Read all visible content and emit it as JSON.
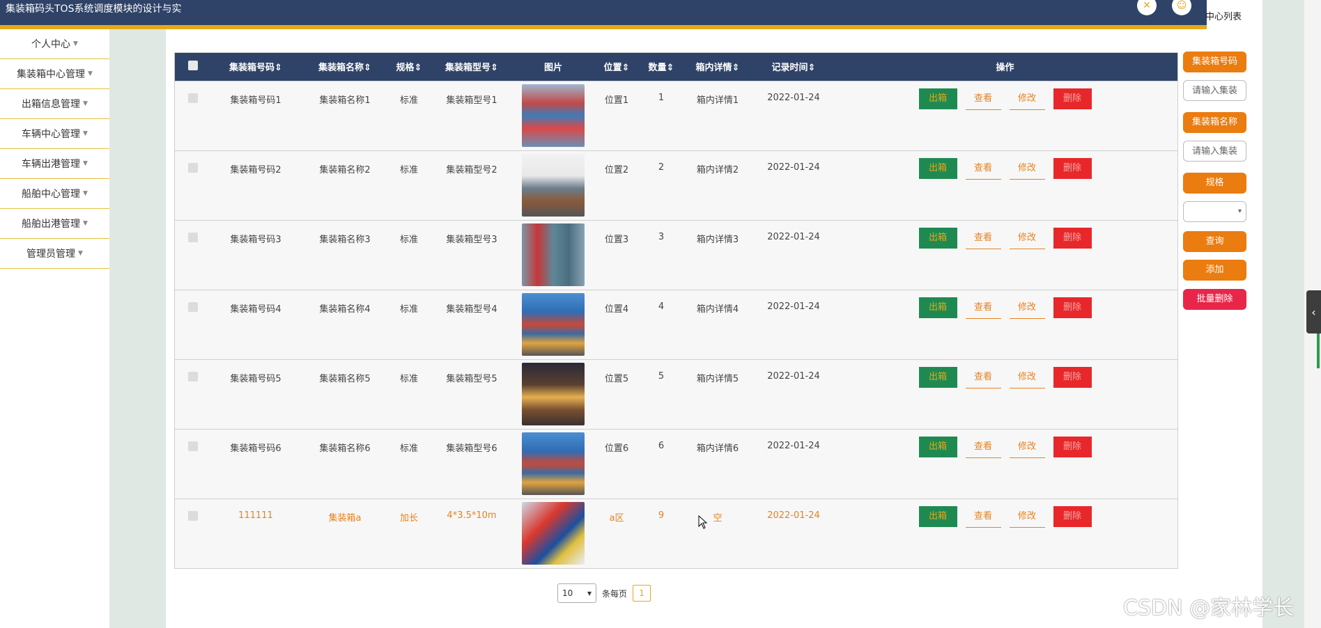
{
  "app": {
    "title": "集装箱码头TOS系统调度模块的设计与实"
  },
  "header": {
    "crumb": "中心列表"
  },
  "sidebar": {
    "items": [
      {
        "label": "个人中心"
      },
      {
        "label": "集装箱中心管理"
      },
      {
        "label": "出箱信息管理"
      },
      {
        "label": "车辆中心管理"
      },
      {
        "label": "车辆出港管理"
      },
      {
        "label": "船舶中心管理"
      },
      {
        "label": "船舶出港管理"
      },
      {
        "label": "管理员管理"
      }
    ]
  },
  "table": {
    "headers": {
      "code": "集装箱号码",
      "name": "集装箱名称",
      "spec": "规格",
      "model": "集装箱型号",
      "image": "图片",
      "position": "位置",
      "qty": "数量",
      "detail": "箱内详情",
      "time": "记录时间",
      "ops": "操作"
    },
    "actions": {
      "out": "出箱",
      "view": "查看",
      "edit": "修改",
      "delete": "删除"
    },
    "rows": [
      {
        "code": "集装箱号码1",
        "name": "集装箱名称1",
        "spec": "标准",
        "model": "集装箱型号1",
        "position": "位置1",
        "qty": "1",
        "detail": "箱内详情1",
        "time": "2022-01-24"
      },
      {
        "code": "集装箱号码2",
        "name": "集装箱名称2",
        "spec": "标准",
        "model": "集装箱型号2",
        "position": "位置2",
        "qty": "2",
        "detail": "箱内详情2",
        "time": "2022-01-24"
      },
      {
        "code": "集装箱号码3",
        "name": "集装箱名称3",
        "spec": "标准",
        "model": "集装箱型号3",
        "position": "位置3",
        "qty": "3",
        "detail": "箱内详情3",
        "time": "2022-01-24"
      },
      {
        "code": "集装箱号码4",
        "name": "集装箱名称4",
        "spec": "标准",
        "model": "集装箱型号4",
        "position": "位置4",
        "qty": "4",
        "detail": "箱内详情4",
        "time": "2022-01-24"
      },
      {
        "code": "集装箱号码5",
        "name": "集装箱名称5",
        "spec": "标准",
        "model": "集装箱型号5",
        "position": "位置5",
        "qty": "5",
        "detail": "箱内详情5",
        "time": "2022-01-24"
      },
      {
        "code": "集装箱号码6",
        "name": "集装箱名称6",
        "spec": "标准",
        "model": "集装箱型号6",
        "position": "位置6",
        "qty": "6",
        "detail": "箱内详情6",
        "time": "2022-01-24"
      },
      {
        "code": "111111",
        "name": "集装箱a",
        "spec": "加长",
        "model": "4*3.5*10m",
        "position": "a区",
        "qty": "9",
        "detail": "空",
        "time": "2022-01-24"
      }
    ]
  },
  "search": {
    "code_label": "集装箱号码",
    "code_placeholder": "请输入集装",
    "name_label": "集装箱名称",
    "name_placeholder": "请输入集装",
    "spec_label": "规格",
    "query": "查询",
    "add": "添加",
    "batch_delete": "批量删除"
  },
  "pagination": {
    "page_size": "10",
    "per_page_label": "条每页",
    "current_page": "1"
  },
  "watermark": "CSDN @家林学长",
  "colors": {
    "header": "#2f4368",
    "accent": "#e6a817",
    "orange": "#ea7c10",
    "green": "#1e8a52",
    "red": "#e8272a"
  },
  "icons": {
    "fullscreen": "fullscreen-icon",
    "user": "user-icon",
    "dropdown": "caret-down-icon",
    "collapse": "chevron-left-icon"
  }
}
